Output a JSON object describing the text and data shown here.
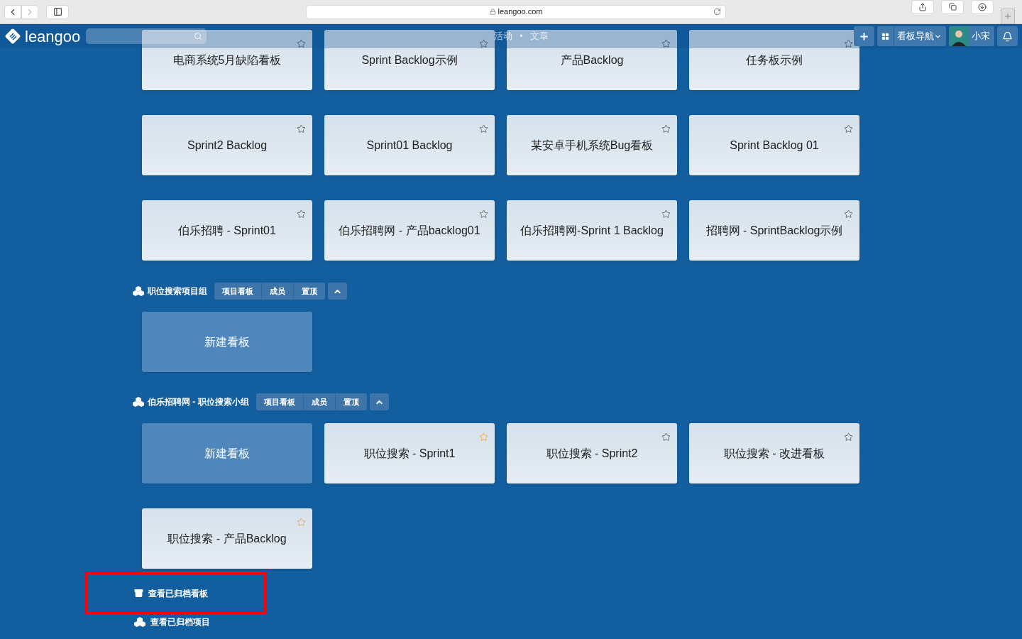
{
  "browser": {
    "url": "leangoo.com"
  },
  "navbar": {
    "logo": "leangoo",
    "links": [
      "活动",
      "•",
      "文章"
    ],
    "board_nav": "看板导航",
    "user": "小宋"
  },
  "board_rows": [
    [
      {
        "title": "电商系统5月缺陷看板",
        "starred": false,
        "kind": "board"
      },
      {
        "title": "Sprint Backlog示例",
        "starred": false,
        "kind": "board"
      },
      {
        "title": "产品Backlog",
        "starred": false,
        "kind": "board"
      },
      {
        "title": "任务板示例",
        "starred": false,
        "kind": "board"
      }
    ],
    [
      {
        "title": "Sprint2 Backlog",
        "starred": false,
        "kind": "board"
      },
      {
        "title": "Sprint01 Backlog",
        "starred": false,
        "kind": "board"
      },
      {
        "title": "某安卓手机系统Bug看板",
        "starred": false,
        "kind": "board"
      },
      {
        "title": "Sprint Backlog 01",
        "starred": false,
        "kind": "board"
      }
    ],
    [
      {
        "title": "伯乐招聘 - Sprint01",
        "starred": false,
        "kind": "board"
      },
      {
        "title": "伯乐招聘网 - 产品backlog01",
        "starred": false,
        "kind": "board"
      },
      {
        "title": "伯乐招聘网-Sprint 1 Backlog",
        "starred": false,
        "kind": "board"
      },
      {
        "title": "招聘网 - SprintBacklog示例",
        "starred": false,
        "kind": "board"
      }
    ]
  ],
  "projects": [
    {
      "title": "职位搜索项目组",
      "actions": [
        "项目看板",
        "成员",
        "置顶"
      ],
      "expanded": true,
      "board_rows": [
        [
          {
            "title": "新建看板",
            "kind": "new"
          }
        ]
      ]
    },
    {
      "title": "伯乐招聘网 - 职位搜索小组",
      "actions": [
        "项目看板",
        "成员",
        "置顶"
      ],
      "expanded": true,
      "board_rows": [
        [
          {
            "title": "新建看板",
            "kind": "new"
          },
          {
            "title": "职位搜索 - Sprint1",
            "starred": true,
            "kind": "board"
          },
          {
            "title": "职位搜索 - Sprint2",
            "starred": false,
            "kind": "board"
          },
          {
            "title": "职位搜索 - 改进看板",
            "starred": false,
            "kind": "board"
          }
        ],
        [
          {
            "title": "职位搜索 - 产品Backlog",
            "starred": true,
            "kind": "board"
          }
        ]
      ]
    }
  ],
  "archive_links": [
    {
      "label": "查看已归档看板",
      "kind": "boards",
      "highlighted": true
    },
    {
      "label": "查看已归档项目",
      "kind": "projects",
      "highlighted": false
    }
  ]
}
